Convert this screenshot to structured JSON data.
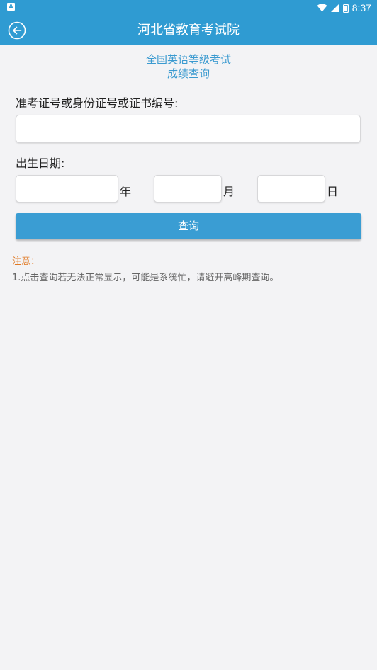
{
  "status_bar": {
    "left_icon": "A",
    "time": "8:37",
    "icons": [
      "wifi-icon",
      "signal-icon",
      "battery-icon"
    ]
  },
  "header": {
    "title": "河北省教育考试院",
    "back_icon": "back-arrow-icon"
  },
  "page": {
    "heading_line1": "全国英语等级考试",
    "heading_line2": "成绩查询"
  },
  "form": {
    "id_label": "准考证号或身份证号或证书编号:",
    "id_value": "",
    "birth_label": "出生日期:",
    "year_unit": "年",
    "month_unit": "月",
    "day_unit": "日",
    "year_value": "",
    "month_value": "",
    "day_value": "",
    "query_button": "查询"
  },
  "notice": {
    "title": "注意：",
    "items": [
      "1.点击查询若无法正常显示，可能是系统忙，请避开高峰期查询。"
    ]
  },
  "colors": {
    "primary": "#2f9bd2",
    "button": "#3a9dd3",
    "heading": "#3a9ad0",
    "notice_title": "#e07a25",
    "background": "#f3f3f5"
  }
}
